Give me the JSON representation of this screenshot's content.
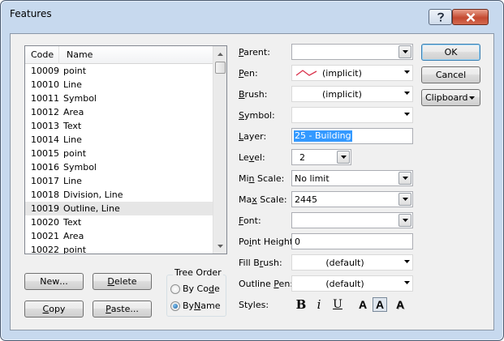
{
  "window": {
    "title": "Features"
  },
  "list": {
    "columns": [
      "Code",
      "Name"
    ],
    "rows": [
      {
        "code": "10009",
        "name": "point"
      },
      {
        "code": "10010",
        "name": "Line"
      },
      {
        "code": "10011",
        "name": "Symbol"
      },
      {
        "code": "10012",
        "name": "Area"
      },
      {
        "code": "10013",
        "name": "Text"
      },
      {
        "code": "10014",
        "name": "Line"
      },
      {
        "code": "10015",
        "name": "point"
      },
      {
        "code": "10016",
        "name": "Symbol"
      },
      {
        "code": "10017",
        "name": "Line"
      },
      {
        "code": "10018",
        "name": "Division, Line"
      },
      {
        "code": "10019",
        "name": "Outline, Line"
      },
      {
        "code": "10020",
        "name": "Text"
      },
      {
        "code": "10021",
        "name": "Area"
      },
      {
        "code": "10022",
        "name": "point"
      }
    ],
    "selected_index": 10
  },
  "buttons": {
    "new": {
      "pre": "New",
      "acc": "",
      "post": "..."
    },
    "delete": {
      "pre": "",
      "acc": "D",
      "post": "elete"
    },
    "copy": {
      "pre": "",
      "acc": "C",
      "post": "opy"
    },
    "paste": {
      "pre": "",
      "acc": "P",
      "post": "aste..."
    },
    "ok": "OK",
    "cancel": "Cancel",
    "clipboard": "Clipboard"
  },
  "tree_order": {
    "title": "Tree Order",
    "options": [
      {
        "pre": "By Co",
        "acc": "d",
        "post": "e",
        "checked": false
      },
      {
        "pre": "By ",
        "acc": "N",
        "post": "ame",
        "checked": true
      }
    ]
  },
  "properties": {
    "parent": {
      "pre": "",
      "acc": "P",
      "post": "arent:",
      "value": ""
    },
    "pen": {
      "pre": "",
      "acc": "P",
      "post": "en:",
      "value": "(implicit)",
      "swatch": "#d9304a"
    },
    "brush": {
      "pre": "",
      "acc": "B",
      "post": "rush:",
      "value": "(implicit)"
    },
    "symbol": {
      "pre": "",
      "acc": "S",
      "post": "ymbol:",
      "value": ""
    },
    "layer": {
      "pre": "",
      "acc": "L",
      "post": "ayer:",
      "value": "25 - Building"
    },
    "level": {
      "pre": "Le",
      "acc": "v",
      "post": "el:",
      "value": "2"
    },
    "min_scale": {
      "pre": "Mi",
      "acc": "n",
      "post": " Scale:",
      "value": "No limit"
    },
    "max_scale": {
      "pre": "Ma",
      "acc": "x",
      "post": " Scale:",
      "value": "2445"
    },
    "font": {
      "pre": "",
      "acc": "F",
      "post": "ont:",
      "value": ""
    },
    "point_height": {
      "pre": "Po",
      "acc": "i",
      "post": "nt Height:",
      "value": "0"
    },
    "fill_brush": {
      "pre": "Fill B",
      "acc": "r",
      "post": "ush:",
      "value": "(default)"
    },
    "outline_pen": {
      "pre": "Outline ",
      "acc": "P",
      "post": "en:",
      "value": "(default)"
    },
    "styles": {
      "label": "Styles:",
      "items": [
        "B",
        "i",
        "U",
        "A",
        "A",
        "A"
      ]
    }
  },
  "colors": {
    "selection": "#3399ff",
    "pen_swatch": "#d9304a"
  }
}
